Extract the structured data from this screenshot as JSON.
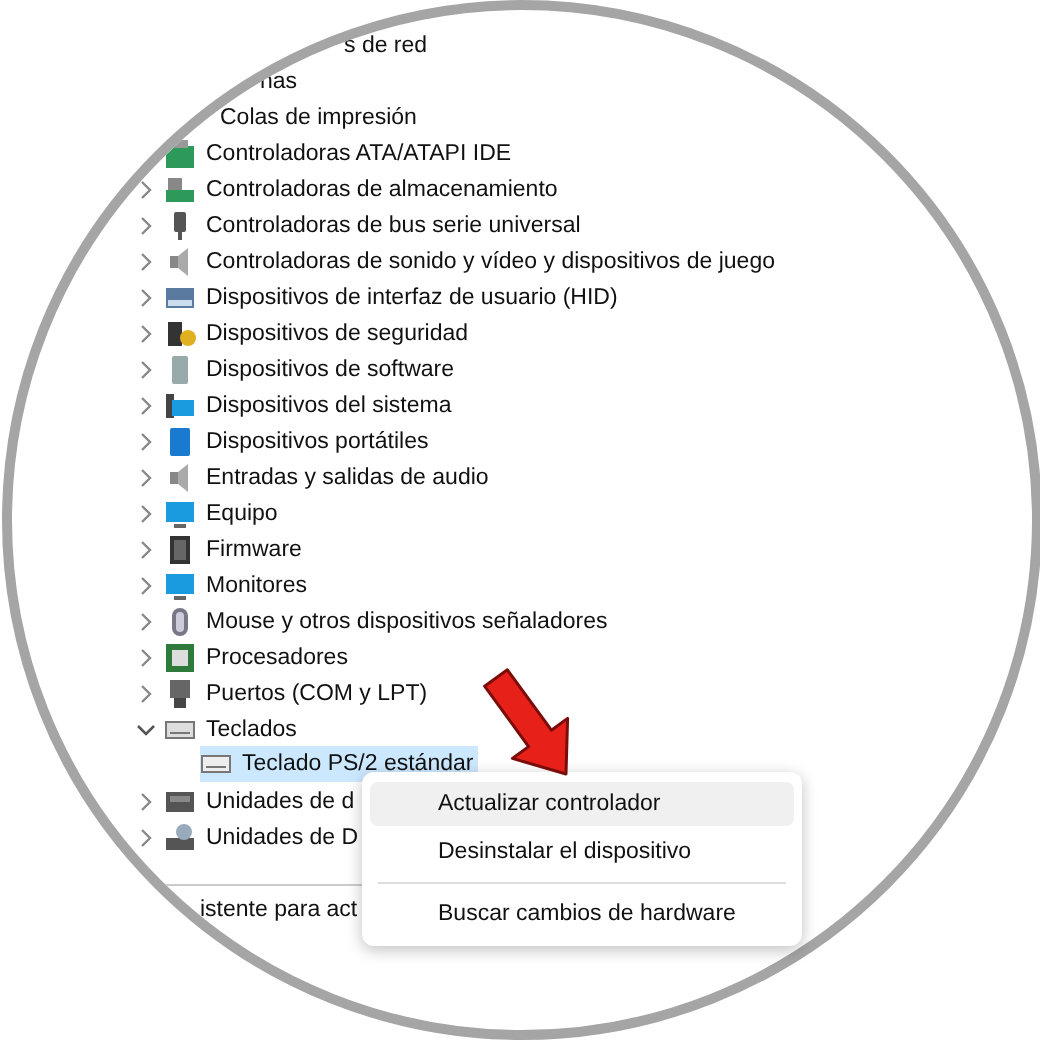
{
  "tree": [
    {
      "label": "s de red",
      "kind": "cut",
      "selected": false
    },
    {
      "label": "nas",
      "kind": "cut",
      "selected": false
    },
    {
      "label": "Colas de impresión",
      "kind": "cut",
      "selected": false
    },
    {
      "label": "Controladoras ATA/ATAPI IDE",
      "kind": "category",
      "selected": false
    },
    {
      "label": "Controladoras de almacenamiento",
      "kind": "category",
      "expanded": false,
      "selected": false
    },
    {
      "label": "Controladoras de bus serie universal",
      "kind": "category",
      "expanded": false,
      "selected": false
    },
    {
      "label": "Controladoras de sonido y vídeo y dispositivos de juego",
      "kind": "category",
      "expanded": false,
      "selected": false
    },
    {
      "label": "Dispositivos de interfaz de usuario (HID)",
      "kind": "category",
      "expanded": false,
      "selected": false
    },
    {
      "label": "Dispositivos de seguridad",
      "kind": "category",
      "expanded": false,
      "selected": false
    },
    {
      "label": "Dispositivos de software",
      "kind": "category",
      "expanded": false,
      "selected": false
    },
    {
      "label": "Dispositivos del sistema",
      "kind": "category",
      "expanded": false,
      "selected": false
    },
    {
      "label": "Dispositivos portátiles",
      "kind": "category",
      "expanded": false,
      "selected": false
    },
    {
      "label": "Entradas y salidas de audio",
      "kind": "category",
      "expanded": false,
      "selected": false
    },
    {
      "label": "Equipo",
      "kind": "category",
      "expanded": false,
      "selected": false
    },
    {
      "label": "Firmware",
      "kind": "category",
      "expanded": false,
      "selected": false
    },
    {
      "label": "Monitores",
      "kind": "category",
      "expanded": false,
      "selected": false
    },
    {
      "label": "Mouse y otros dispositivos señaladores",
      "kind": "category",
      "expanded": false,
      "selected": false
    },
    {
      "label": "Procesadores",
      "kind": "category",
      "expanded": false,
      "selected": false
    },
    {
      "label": "Puertos (COM y LPT)",
      "kind": "category",
      "expanded": false,
      "selected": false
    },
    {
      "label": "Teclados",
      "kind": "category",
      "expanded": true,
      "selected": false,
      "children": [
        {
          "label": "Teclado PS/2 estándar",
          "kind": "device",
          "selected": true
        }
      ]
    },
    {
      "label": "Unidades de d",
      "kind": "category",
      "expanded": false,
      "selected": false
    },
    {
      "label": "Unidades de D",
      "kind": "category",
      "expanded": false,
      "selected": false
    }
  ],
  "status_bar": {
    "text": "istente para act"
  },
  "context_menu": {
    "items": [
      {
        "label": "Actualizar controlador",
        "selected": true
      },
      {
        "label": "Desinstalar el dispositivo",
        "selected": false
      },
      {
        "label": "Buscar cambios de hardware",
        "selected": false,
        "separator_before": true
      }
    ]
  }
}
